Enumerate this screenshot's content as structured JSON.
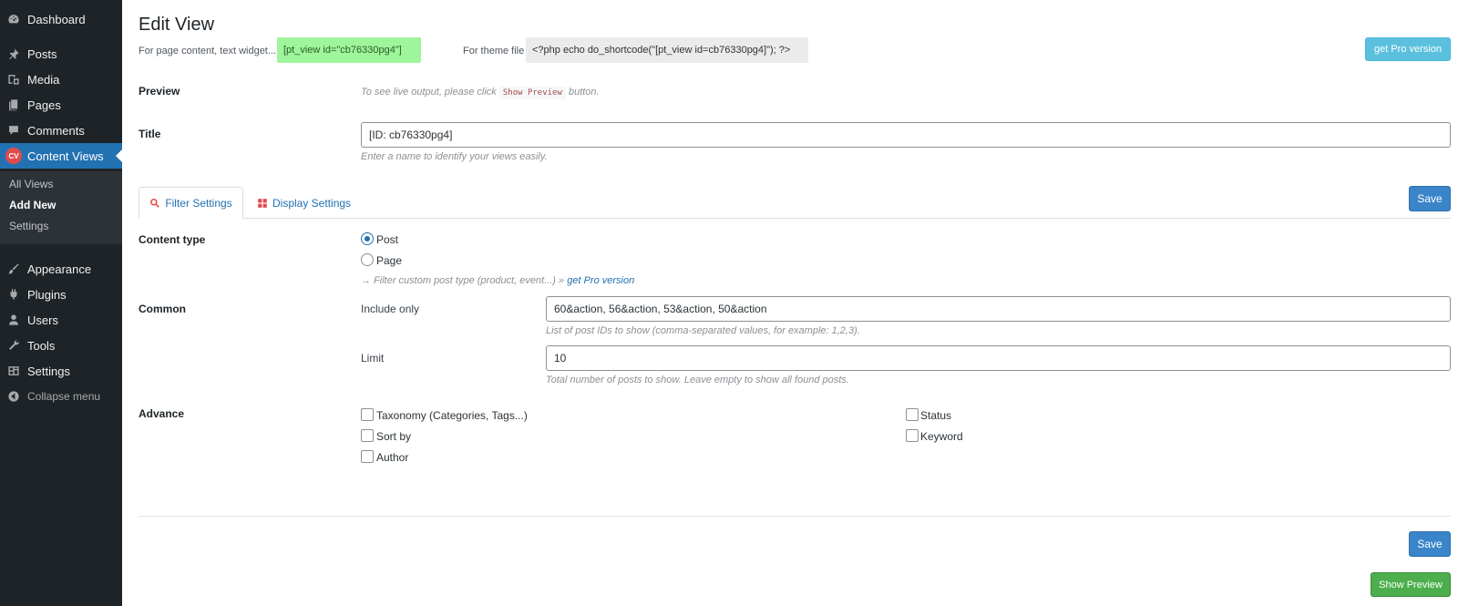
{
  "sidebar": {
    "items": [
      {
        "label": "Dashboard",
        "icon": "dashboard-icon"
      },
      {
        "label": "Posts",
        "icon": "pin-icon"
      },
      {
        "label": "Media",
        "icon": "media-icon"
      },
      {
        "label": "Pages",
        "icon": "pages-icon"
      },
      {
        "label": "Comments",
        "icon": "comment-icon"
      },
      {
        "label": "Content Views",
        "icon": "cv-badge-icon",
        "badge": "CV"
      },
      {
        "label": "Appearance",
        "icon": "brush-icon"
      },
      {
        "label": "Plugins",
        "icon": "plug-icon"
      },
      {
        "label": "Users",
        "icon": "user-icon"
      },
      {
        "label": "Tools",
        "icon": "wrench-icon"
      },
      {
        "label": "Settings",
        "icon": "settings-icon"
      }
    ],
    "submenu": [
      {
        "label": "All Views"
      },
      {
        "label": "Add New"
      },
      {
        "label": "Settings"
      }
    ],
    "collapse_label": "Collapse menu"
  },
  "page": {
    "title": "Edit View",
    "shortcode_label_1": "For page content, text widget...",
    "shortcode_value_1": "[pt_view id=\"cb76330pg4\"]",
    "shortcode_label_2": "For theme file",
    "shortcode_value_2": "<?php echo do_shortcode(\"[pt_view id=cb76330pg4]\"); ?>",
    "pro_button": "get Pro version"
  },
  "preview": {
    "label": "Preview",
    "hint_before": "To see live output, please click",
    "hint_code": "Show Preview",
    "hint_after": "button."
  },
  "title_field": {
    "label": "Title",
    "value": "[ID: cb76330pg4]",
    "hint": "Enter a name to identify your views easily."
  },
  "tabs": [
    {
      "label": "Filter Settings",
      "icon": "search-icon"
    },
    {
      "label": "Display Settings",
      "icon": "grid-icon"
    }
  ],
  "save_label": "Save",
  "content_type": {
    "label": "Content type",
    "options": [
      "Post",
      "Page"
    ],
    "selected": "Post",
    "hint_text": "→ Filter custom post type (product, event...) »",
    "hint_link": "get Pro version"
  },
  "common": {
    "label": "Common",
    "include_label": "Include only",
    "include_value": "60&action, 56&action, 53&action, 50&action",
    "include_hint": "List of post IDs to show (comma-separated values, for example: 1,2,3).",
    "limit_label": "Limit",
    "limit_value": "10",
    "limit_hint": "Total number of posts to show. Leave empty to show all found posts."
  },
  "advance": {
    "label": "Advance",
    "options": [
      "Taxonomy (Categories, Tags...)",
      "Sort by",
      "Author",
      "Status",
      "Keyword"
    ]
  },
  "preview_button": "Show Preview",
  "colors": {
    "sidebar_bg": "#1d2327",
    "accent": "#2271b1",
    "shortcode_green": "#9ff59b",
    "pro_button": "#5bc0de",
    "preview_button": "#4cae4c"
  }
}
